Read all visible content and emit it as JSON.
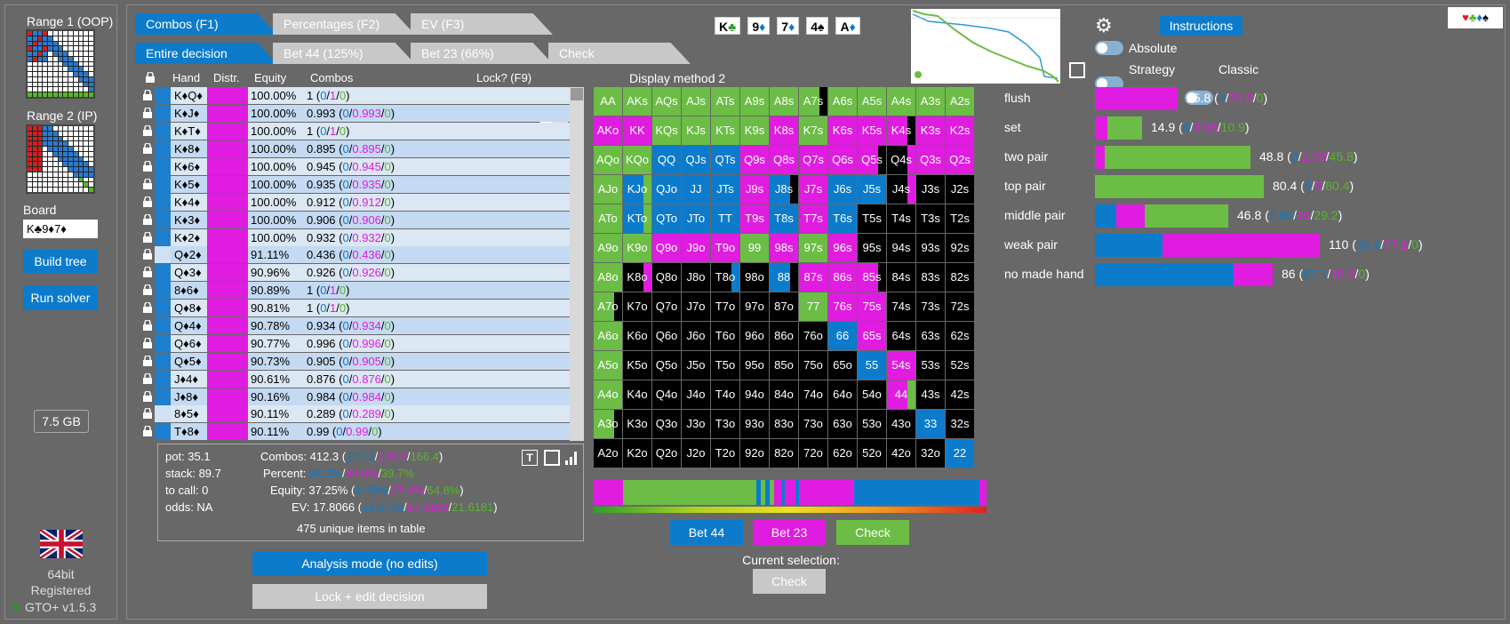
{
  "sidebar": {
    "range1_label": "Range 1 (OOP)",
    "range2_label": "Range 2 (IP)",
    "board_label": "Board",
    "board_value": "K♣9♦7♦",
    "build_tree": "Build tree",
    "run_solver": "Run solver",
    "memory": "7.5 GB",
    "bitness": "64bit",
    "registered": "Registered",
    "version": "GTO+ v1.5.3"
  },
  "tabs": {
    "row1": [
      "Combos (F1)",
      "Percentages (F2)",
      "EV (F3)"
    ],
    "row2": [
      "Entire decision",
      "Bet 44 (125%)",
      "Bet 23 (66%)",
      "Check"
    ]
  },
  "board_cards": [
    {
      "rank": "K",
      "suit": "♣"
    },
    {
      "rank": "9",
      "suit": "♦"
    },
    {
      "rank": "7",
      "suit": "♦"
    },
    {
      "rank": "4",
      "suit": "♠"
    },
    {
      "rank": "A",
      "suit": "♦"
    }
  ],
  "options": {
    "instructions": "Instructions",
    "absolute": "Absolute",
    "strategy": "Strategy",
    "classic": "Classic",
    "display_method": "Display method 2",
    "lock_label": "Lock? (F9)"
  },
  "table": {
    "headers": [
      "Hand",
      "Distr.",
      "Equity",
      "Combos"
    ],
    "rows": [
      {
        "hand": "K♦Q♦",
        "equity": "100.00%",
        "total": "1",
        "a": "0",
        "b": "1",
        "c": "0"
      },
      {
        "hand": "K♦J♦",
        "equity": "100.00%",
        "total": "0.993",
        "a": "0",
        "b": "0.993",
        "c": "0"
      },
      {
        "hand": "K♦T♦",
        "equity": "100.00%",
        "total": "1",
        "a": "0",
        "b": "1",
        "c": "0"
      },
      {
        "hand": "K♦8♦",
        "equity": "100.00%",
        "total": "0.895",
        "a": "0",
        "b": "0.895",
        "c": "0"
      },
      {
        "hand": "K♦6♦",
        "equity": "100.00%",
        "total": "0.945",
        "a": "0",
        "b": "0.945",
        "c": "0"
      },
      {
        "hand": "K♦5♦",
        "equity": "100.00%",
        "total": "0.935",
        "a": "0",
        "b": "0.935",
        "c": "0"
      },
      {
        "hand": "K♦4♦",
        "equity": "100.00%",
        "total": "0.912",
        "a": "0",
        "b": "0.912",
        "c": "0"
      },
      {
        "hand": "K♦3♦",
        "equity": "100.00%",
        "total": "0.906",
        "a": "0",
        "b": "0.906",
        "c": "0"
      },
      {
        "hand": "K♦2♦",
        "equity": "100.00%",
        "total": "0.932",
        "a": "0",
        "b": "0.932",
        "c": "0"
      },
      {
        "hand": "Q♦2♦",
        "equity": "91.11%",
        "total": "0.436",
        "a": "0",
        "b": "0.436",
        "c": "0"
      },
      {
        "hand": "Q♦3♦",
        "equity": "90.96%",
        "total": "0.926",
        "a": "0",
        "b": "0.926",
        "c": "0"
      },
      {
        "hand": "8♦6♦",
        "equity": "90.89%",
        "total": "1",
        "a": "0",
        "b": "1",
        "c": "0"
      },
      {
        "hand": "Q♦8♦",
        "equity": "90.81%",
        "total": "1",
        "a": "0",
        "b": "1",
        "c": "0"
      },
      {
        "hand": "Q♦4♦",
        "equity": "90.78%",
        "total": "0.934",
        "a": "0",
        "b": "0.934",
        "c": "0"
      },
      {
        "hand": "Q♦6♦",
        "equity": "90.77%",
        "total": "0.996",
        "a": "0",
        "b": "0.996",
        "c": "0"
      },
      {
        "hand": "Q♦5♦",
        "equity": "90.73%",
        "total": "0.905",
        "a": "0",
        "b": "0.905",
        "c": "0"
      },
      {
        "hand": "J♦4♦",
        "equity": "90.61%",
        "total": "0.876",
        "a": "0",
        "b": "0.876",
        "c": "0"
      },
      {
        "hand": "J♦8♦",
        "equity": "90.16%",
        "total": "0.984",
        "a": "0",
        "b": "0.984",
        "c": "0"
      },
      {
        "hand": "8♦5♦",
        "equity": "90.11%",
        "total": "0.289",
        "a": "0",
        "b": "0.289",
        "c": "0"
      },
      {
        "hand": "T♦8♦",
        "equity": "90.11%",
        "total": "0.99",
        "a": "0",
        "b": "0.99",
        "c": "0"
      }
    ]
  },
  "stats": {
    "pot": "pot: 35.1",
    "stack": "stack: 89.7",
    "to_call": "to call: 0",
    "odds": "odds: NA",
    "combos_label": "Combos: 412.3 (",
    "combos_a": "107.2",
    "combos_b": "138.8",
    "combos_c": "166.4",
    "percent_label": "Percent: ",
    "percent_a": "26.3%",
    "percent_b": "34.0%",
    "percent_c": "39.7%",
    "equity_label": "Equity: 37.25% (",
    "equity_a": "8.49%",
    "equity_b": "27.4%",
    "equity_c": "64.8%",
    "ev_label": "EV: 17.8066 (",
    "ev_a": "12.5703",
    "ev_b": "17.4169",
    "ev_c": "21.6181",
    "unique": "475 unique items in table"
  },
  "buttons": {
    "analysis": "Analysis mode (no edits)",
    "lock_edit": "Lock + edit decision",
    "bet44": "Bet 44",
    "bet23": "Bet 23",
    "check": "Check",
    "current_selection": "Current selection:",
    "current_value": "Check"
  },
  "categories": [
    {
      "name": "flush",
      "total": "25.8",
      "a": "0",
      "b": "25.8",
      "c": "0",
      "mix": [
        0,
        1,
        0
      ],
      "scale": 0.49
    },
    {
      "name": "set",
      "total": "14.9",
      "a": "0",
      "b": "3.96",
      "c": "10.9",
      "mix": [
        0,
        0.27,
        0.73
      ],
      "scale": 0.28
    },
    {
      "name": "two pair",
      "total": "48.8",
      "a": "0",
      "b": "2.99",
      "c": "45.8",
      "mix": [
        0,
        0.06,
        0.94
      ],
      "scale": 0.92
    },
    {
      "name": "top pair",
      "total": "80.4",
      "a": "0",
      "b": "0",
      "c": "80.4",
      "mix": [
        0,
        0,
        1
      ],
      "scale": 1.0
    },
    {
      "name": "middle pair",
      "total": "46.8",
      "a": "7.65",
      "b": "10",
      "c": "29.2",
      "mix": [
        0.16,
        0.21,
        0.63
      ],
      "scale": 0.79
    },
    {
      "name": "weak pair",
      "total": "110",
      "a": "32.4",
      "b": "77.1",
      "c": "0",
      "mix": [
        0.3,
        0.7,
        0
      ],
      "scale": 1.33
    },
    {
      "name": "no made hand",
      "total": "86",
      "a": "67.1",
      "b": "18.9",
      "c": "0",
      "mix": [
        0.78,
        0.22,
        0
      ],
      "scale": 1.05
    }
  ],
  "colors": {
    "bet44": "#0c7bcc",
    "bet23": "#e01ce0",
    "check": "#6cbd45",
    "fold": "#000000"
  },
  "grid_labels": [
    [
      "AA",
      "AKs",
      "AQs",
      "AJs",
      "ATs",
      "A9s",
      "A8s",
      "A7s",
      "A6s",
      "A5s",
      "A4s",
      "A3s",
      "A2s"
    ],
    [
      "AKo",
      "KK",
      "KQs",
      "KJs",
      "KTs",
      "K9s",
      "K8s",
      "K7s",
      "K6s",
      "K5s",
      "K4s",
      "K3s",
      "K2s"
    ],
    [
      "AQo",
      "KQo",
      "QQ",
      "QJs",
      "QTs",
      "Q9s",
      "Q8s",
      "Q7s",
      "Q6s",
      "Q5s",
      "Q4s",
      "Q3s",
      "Q2s"
    ],
    [
      "AJo",
      "KJo",
      "QJo",
      "JJ",
      "JTs",
      "J9s",
      "J8s",
      "J7s",
      "J6s",
      "J5s",
      "J4s",
      "J3s",
      "J2s"
    ],
    [
      "ATo",
      "KTo",
      "QTo",
      "JTo",
      "TT",
      "T9s",
      "T8s",
      "T7s",
      "T6s",
      "T5s",
      "T4s",
      "T3s",
      "T2s"
    ],
    [
      "A9o",
      "K9o",
      "Q9o",
      "J9o",
      "T9o",
      "99",
      "98s",
      "97s",
      "96s",
      "95s",
      "94s",
      "93s",
      "92s"
    ],
    [
      "A8o",
      "K8o",
      "Q8o",
      "J8o",
      "T8o",
      "98o",
      "88",
      "87s",
      "86s",
      "85s",
      "84s",
      "83s",
      "82s"
    ],
    [
      "A7o",
      "K7o",
      "Q7o",
      "J7o",
      "T7o",
      "97o",
      "87o",
      "77",
      "76s",
      "75s",
      "74s",
      "73s",
      "72s"
    ],
    [
      "A6o",
      "K6o",
      "Q6o",
      "J6o",
      "T6o",
      "96o",
      "86o",
      "76o",
      "66",
      "65s",
      "64s",
      "63s",
      "62s"
    ],
    [
      "A5o",
      "K5o",
      "Q5o",
      "J5o",
      "T5o",
      "95o",
      "85o",
      "75o",
      "65o",
      "55",
      "54s",
      "53s",
      "52s"
    ],
    [
      "A4o",
      "K4o",
      "Q4o",
      "J4o",
      "T4o",
      "94o",
      "84o",
      "74o",
      "64o",
      "54o",
      "44",
      "43s",
      "42s"
    ],
    [
      "A3o",
      "K3o",
      "Q3o",
      "J3o",
      "T3o",
      "93o",
      "83o",
      "73o",
      "63o",
      "53o",
      "43o",
      "33",
      "32s"
    ],
    [
      "A2o",
      "K2o",
      "Q2o",
      "J2o",
      "T2o",
      "92o",
      "82o",
      "72o",
      "62o",
      "52o",
      "42o",
      "32o",
      "22"
    ]
  ],
  "grid_colors": [
    [
      "G",
      "G",
      "G",
      "G",
      "G",
      "G",
      "G",
      "GK",
      "G",
      "G",
      "G",
      "G",
      "G"
    ],
    [
      "P",
      "P",
      "G",
      "G",
      "G",
      "G",
      "P",
      "G",
      "P",
      "P",
      "PK",
      "P",
      "P"
    ],
    [
      "G",
      "G",
      "B",
      "B",
      "B",
      "P",
      "P",
      "P",
      "P",
      "PK",
      "KP",
      "P",
      "P"
    ],
    [
      "G",
      "BG",
      "B",
      "B",
      "B",
      "P",
      "BK",
      "P",
      "B",
      "B",
      "KP",
      "K",
      "K"
    ],
    [
      "G",
      "BG",
      "B",
      "B",
      "B",
      "P",
      "B",
      "P",
      "B",
      "K",
      "K",
      "K",
      "K"
    ],
    [
      "G",
      "G",
      "P",
      "P",
      "P",
      "G",
      "P",
      "G",
      "P",
      "K",
      "K",
      "K",
      "K"
    ],
    [
      "G",
      "KP",
      "K",
      "K",
      "KB",
      "K",
      "BK",
      "P",
      "P",
      "PK",
      "K",
      "K",
      "K"
    ],
    [
      "GK",
      "K",
      "K",
      "K",
      "K",
      "K",
      "K",
      "G",
      "P",
      "P",
      "K",
      "K",
      "K"
    ],
    [
      "G",
      "K",
      "K",
      "K",
      "K",
      "K",
      "K",
      "K",
      "B",
      "P",
      "K",
      "K",
      "K"
    ],
    [
      "G",
      "K",
      "K",
      "K",
      "K",
      "K",
      "K",
      "K",
      "K",
      "B",
      "P",
      "K",
      "K"
    ],
    [
      "G",
      "K",
      "K",
      "K",
      "K",
      "K",
      "K",
      "K",
      "K",
      "K",
      "PG",
      "K",
      "K"
    ],
    [
      "GK",
      "K",
      "K",
      "K",
      "K",
      "K",
      "K",
      "K",
      "K",
      "K",
      "K",
      "B",
      "K"
    ],
    [
      "K",
      "K",
      "K",
      "K",
      "K",
      "K",
      "K",
      "K",
      "K",
      "K",
      "K",
      "K",
      "B"
    ]
  ]
}
